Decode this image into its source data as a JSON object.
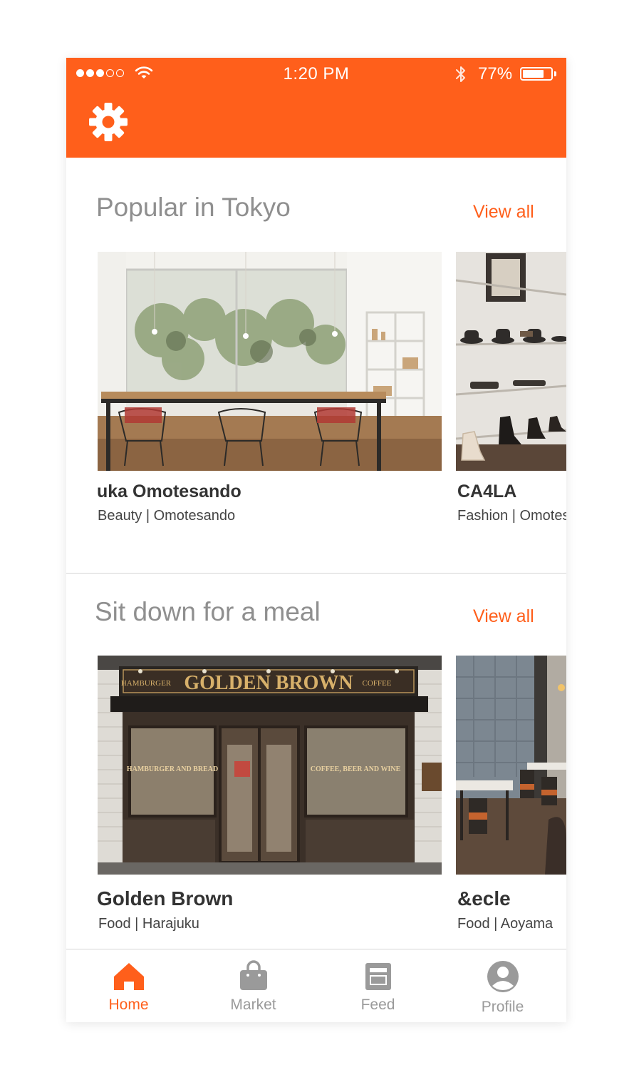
{
  "status_bar": {
    "time": "1:20 PM",
    "battery_percent": "77%",
    "battery_level": 0.77,
    "signal_bars_filled": 3,
    "signal_bars_total": 5,
    "icons": [
      "wifi-icon",
      "bluetooth-icon",
      "battery-icon"
    ]
  },
  "header": {
    "settings_icon": "gear-icon"
  },
  "colors": {
    "accent": "#ff5f1b",
    "title_gray": "#8f8f8f",
    "text_dark": "#333333",
    "tab_inactive": "#9a9a9a"
  },
  "sections": [
    {
      "title": "Popular in Tokyo",
      "view_all": "View all",
      "cards": [
        {
          "name": "uka Omotesando",
          "meta": "Beauty | Omotesando",
          "image": "cafe-interior-photo"
        },
        {
          "name": "CA4LA",
          "meta": "Fashion | Omotesando",
          "image": "hat-shop-photo"
        }
      ]
    },
    {
      "title": "Sit down for a meal",
      "view_all": "View all",
      "cards": [
        {
          "name": "Golden Brown",
          "meta": "Food | Harajuku",
          "image": "restaurant-storefront-photo",
          "sign_text": "GOLDEN BROWN",
          "sign_left": "HAMBURGER",
          "sign_right": "COFFEE",
          "window_left": "HAMBURGER AND BREAD",
          "window_right": "COFFEE, BEER AND WINE"
        },
        {
          "name": "&ecle",
          "meta": "Food | Aoyama",
          "image": "dining-room-photo"
        }
      ]
    }
  ],
  "tabs": [
    {
      "label": "Home",
      "icon": "home-icon",
      "active": true
    },
    {
      "label": "Market",
      "icon": "shopping-bag-icon",
      "active": false
    },
    {
      "label": "Feed",
      "icon": "newspaper-icon",
      "active": false
    },
    {
      "label": "Profile",
      "icon": "user-avatar-icon",
      "active": false
    }
  ]
}
